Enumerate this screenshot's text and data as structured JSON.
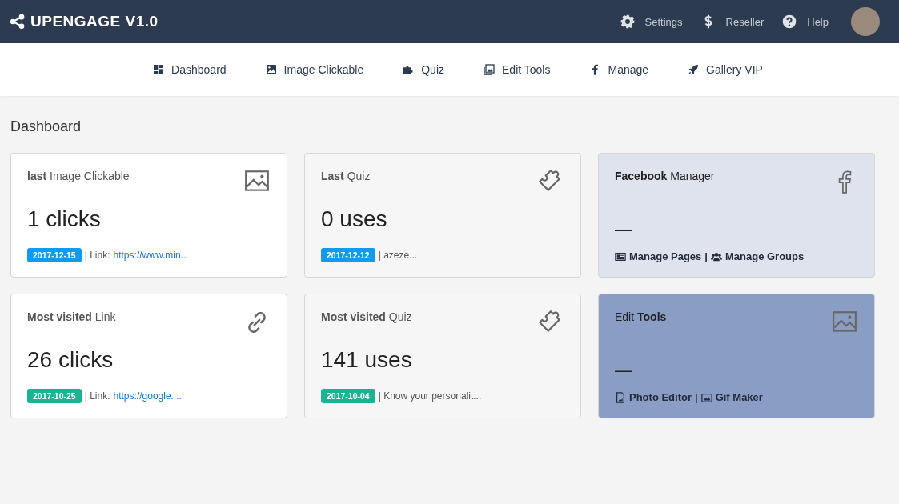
{
  "brand": {
    "title": "UPENGAGE V1.0"
  },
  "top_menu": [
    {
      "label": "Settings"
    },
    {
      "label": "Reseller"
    },
    {
      "label": "Help"
    }
  ],
  "nav": [
    {
      "label": "Dashboard"
    },
    {
      "label": "Image Clickable"
    },
    {
      "label": "Quiz"
    },
    {
      "label": "Edit Tools"
    },
    {
      "label": "Manage"
    },
    {
      "label": "Gallery VIP"
    }
  ],
  "page_title": "Dashboard",
  "cards": [
    {
      "kind": "stat",
      "color": "#ffffff",
      "title": "**last** Image Clickable",
      "value": "1 clicks",
      "badge": {
        "text": "2017-12-15",
        "color": "#0d9cf2"
      },
      "note": "| Link:",
      "link": "https://www.min..."
    },
    {
      "kind": "stat",
      "color": "#f6f6f6",
      "title": "**Last** Quiz",
      "value": "0 uses",
      "badge": {
        "text": "2017-12-12",
        "color": "#0d9cf2"
      },
      "note": "| azeze..."
    },
    {
      "kind": "tools",
      "color": "#dfe3ee",
      "title": "**Facebook** Manager",
      "value": "—",
      "links": [
        {
          "text": "Manage Pages"
        },
        {
          "text": "Manage Groups"
        }
      ],
      "separator": "|"
    },
    {
      "kind": "stat",
      "color": "#ffffff",
      "title": "**Most visited** Link",
      "value": "26 clicks",
      "badge": {
        "text": "2017-10-25",
        "color": "#1bb394"
      },
      "note": "| Link:",
      "link": "https://google...."
    },
    {
      "kind": "stat",
      "color": "#f6f6f6",
      "title": "**Most visited** Quiz",
      "value": "141 uses",
      "badge": {
        "text": "2017-10-04",
        "color": "#1bb394"
      },
      "note": "| Know your personalit..."
    },
    {
      "kind": "tools",
      "color": "#8a9dc5",
      "title": "Edit **Tools**",
      "value": "—",
      "links": [
        {
          "text": "Photo Editor"
        },
        {
          "text": "Gif Maker"
        }
      ],
      "separator": "|"
    }
  ]
}
